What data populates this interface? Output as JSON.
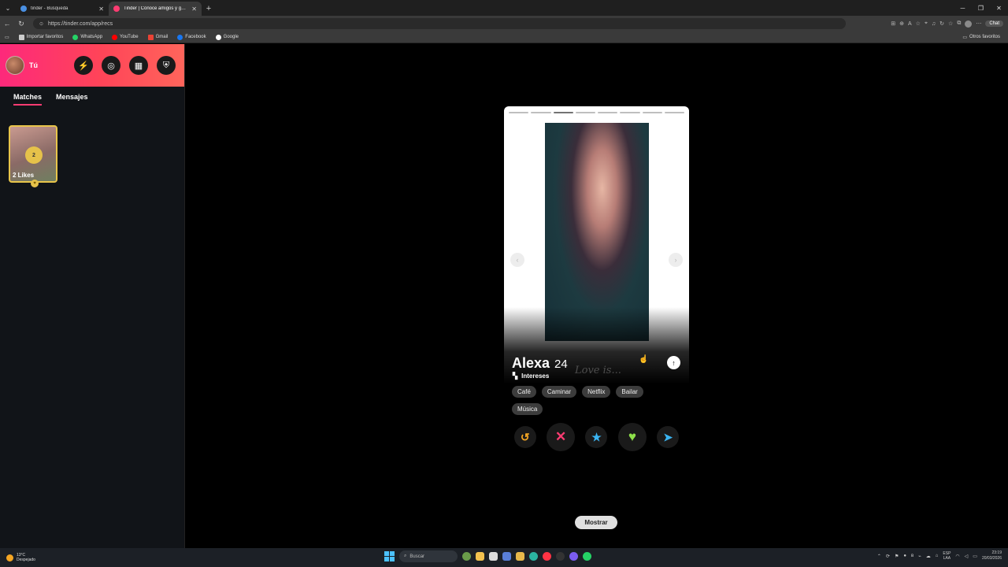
{
  "browser": {
    "tabs": [
      {
        "title": "tinder - Búsqueda",
        "active": false
      },
      {
        "title": "Tinder | Conoce amigos y gente n...",
        "active": true
      }
    ],
    "url": "https://tinder.com/app/recs",
    "chat_label": "Chat",
    "bookmarks": [
      {
        "label": "Importar favoritos",
        "icon": "import-icon",
        "color": "#cccccc"
      },
      {
        "label": "WhatsApp",
        "icon": "whatsapp-icon",
        "color": "#25d366"
      },
      {
        "label": "YouTube",
        "icon": "youtube-icon",
        "color": "#ff0000"
      },
      {
        "label": "Gmail",
        "icon": "gmail-icon",
        "color": "#ea4335"
      },
      {
        "label": "Facebook",
        "icon": "facebook-icon",
        "color": "#1877f2"
      },
      {
        "label": "Google",
        "icon": "google-icon",
        "color": "#ffffff"
      }
    ],
    "other_favorites": "Otros favoritos"
  },
  "sidebar": {
    "user_label": "Tú",
    "tabs": [
      "Matches",
      "Mensajes"
    ],
    "likes": {
      "count": "2",
      "label": "2 Likes"
    }
  },
  "profile": {
    "name": "Alexa",
    "age": "24",
    "watermark": "Love is...",
    "interests_title": "Intereses",
    "interests": [
      "Café",
      "Caminar",
      "Netflix",
      "Bailar",
      "Música"
    ],
    "photo_count": 8,
    "current_photo": 3
  },
  "actions": {
    "rewind": "↺",
    "nope": "✕",
    "super_like": "★",
    "like": "♥",
    "boost": "➤"
  },
  "show_button": "Mostrar",
  "taskbar": {
    "temperature": "13°C",
    "weather": "Despejado",
    "search_placeholder": "Buscar",
    "lang_top": "ESP",
    "lang_bottom": "LAA",
    "time": "23:19",
    "date": "20/03/2026"
  },
  "colors": {
    "tinder_gradient_start": "#fd297b",
    "tinder_gradient_end": "#ff655b",
    "likes_gold": "#e6c24a"
  }
}
